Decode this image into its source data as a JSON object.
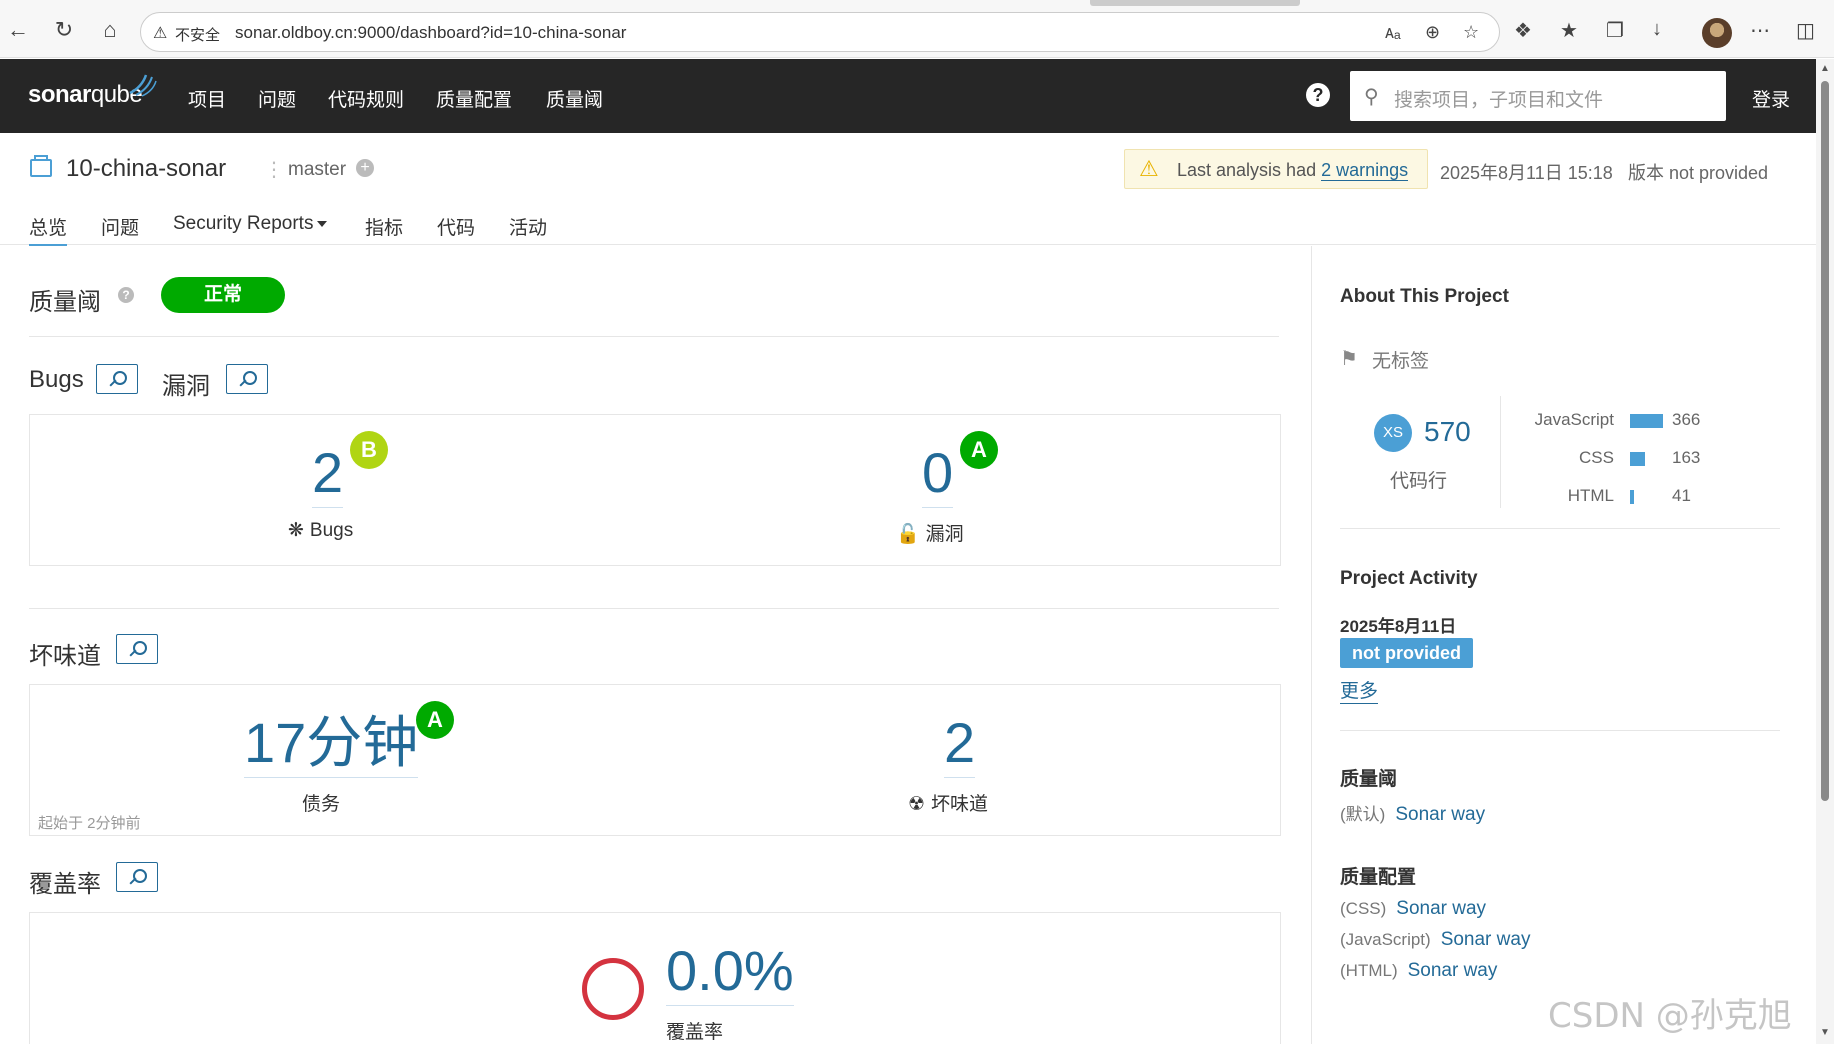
{
  "browser": {
    "insecure_label": "不安全",
    "url": "sonar.oldboy.cn:9000/dashboard?id=10-china-sonar"
  },
  "nav": {
    "logo_a": "sonar",
    "logo_b": "qube",
    "menu": [
      "项目",
      "问题",
      "代码规则",
      "质量配置",
      "质量阈"
    ],
    "search_placeholder": "搜索项目，子项目和文件",
    "login": "登录"
  },
  "project": {
    "name": "10-china-sonar",
    "branch": "master",
    "warning_prefix": "Last analysis had ",
    "warning_link": "2 warnings",
    "analysis_date": "2025年8月11日 15:18",
    "version": "版本 not provided",
    "tabs": [
      "总览",
      "问题",
      "Security Reports",
      "指标",
      "代码",
      "活动"
    ]
  },
  "quality_gate": {
    "title": "质量阈",
    "status": "正常"
  },
  "reliability": {
    "bugs_title": "Bugs",
    "vuln_title": "漏洞",
    "bugs_value": "2",
    "bugs_rating": "B",
    "bugs_label": "Bugs",
    "vuln_value": "0",
    "vuln_rating": "A",
    "vuln_label": "漏洞"
  },
  "maintainability": {
    "title": "坏味道",
    "debt_value": "17分钟",
    "debt_rating": "A",
    "debt_label": "债务",
    "since": "起始于 2分钟前",
    "smells_value": "2",
    "smells_label": "坏味道"
  },
  "coverage": {
    "title": "覆盖率",
    "value": "0.0%",
    "label": "覆盖率"
  },
  "sidebar": {
    "about_title": "About This Project",
    "tags": "无标签",
    "size_badge": "XS",
    "loc_value": "570",
    "loc_label": "代码行",
    "languages": [
      {
        "name": "JavaScript",
        "lines": 366
      },
      {
        "name": "CSS",
        "lines": 163
      },
      {
        "name": "HTML",
        "lines": 41
      }
    ],
    "activity_title": "Project Activity",
    "activity_date": "2025年8月11日",
    "activity_version": "not provided",
    "more": "更多",
    "qg_title": "质量阈",
    "qg_default": "(默认)",
    "qg_link": "Sonar way",
    "qp_title": "质量配置",
    "profiles": [
      {
        "lang": "(CSS)",
        "name": "Sonar way"
      },
      {
        "lang": "(JavaScript)",
        "name": "Sonar way"
      },
      {
        "lang": "(HTML)",
        "name": "Sonar way"
      }
    ]
  },
  "watermark": "CSDN @孙克旭",
  "colors": {
    "nav_bg": "#262626",
    "link": "#236a97",
    "accent": "#4b9fd5",
    "pass": "#00aa00",
    "rating_b": "#b0d513",
    "coverage_ring": "#d4333f"
  }
}
